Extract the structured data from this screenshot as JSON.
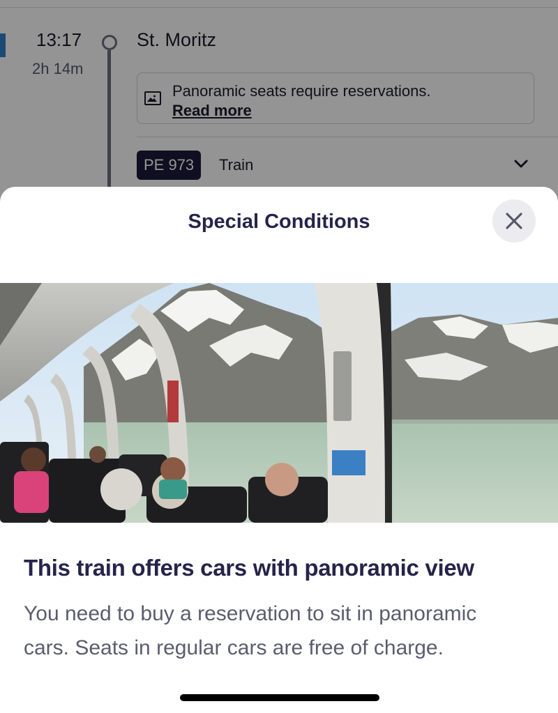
{
  "background": {
    "departure_time": "13:17",
    "duration": "2h 14m",
    "station": "St. Moritz",
    "notice_text": "Panoramic seats require reservations.",
    "notice_link": "Read more",
    "train_number": "PE 973",
    "train_type": "Train"
  },
  "modal": {
    "title": "Special Conditions",
    "image_subject": "panoramic-train-car-interior",
    "heading": "This train offers cars with panoramic view",
    "body": "You need to buy a reservation to sit in panoramic cars. Seats in regular cars are free of charge."
  },
  "colors": {
    "title_text": "#26244a",
    "body_text": "#5b5c6e",
    "badge_bg": "#1b1b3a",
    "close_bg": "#ececf0",
    "accent": "#2f80c9"
  },
  "icons": {
    "notice": "image-icon",
    "close": "close-icon",
    "expand": "chevron-down-icon"
  }
}
